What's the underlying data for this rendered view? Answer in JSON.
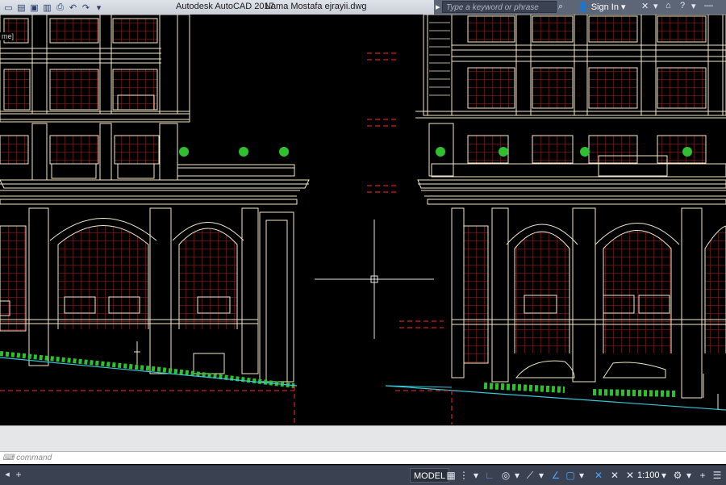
{
  "app": {
    "title": "Autodesk AutoCAD 2017",
    "filename": "Nama Mostafa ejrayii.dwg"
  },
  "search": {
    "placeholder": "Type a keyword or phrase"
  },
  "account": {
    "signin_label": "Sign In"
  },
  "viewport": {
    "label": "me]"
  },
  "command": {
    "placeholder": "command"
  },
  "status": {
    "model_label": "MODEL",
    "scale_label": "1:100"
  },
  "icons": {
    "qat": [
      "new-icon",
      "open-icon",
      "save-icon",
      "saveas-icon",
      "print-icon",
      "undo-icon",
      "redo-icon",
      "dropdown-icon"
    ],
    "titlebar_right": [
      "search-icon",
      "user-icon",
      "exchange-icon",
      "help-icon",
      "minimize-icon"
    ]
  },
  "colors": {
    "drawing_line": "#f2e8c9",
    "window_red": "#8b1c1c",
    "dash_red": "#d42020",
    "ground_cyan": "#38c8d8",
    "plant_green": "#2ec02e",
    "canvas_bg": "#000000"
  }
}
